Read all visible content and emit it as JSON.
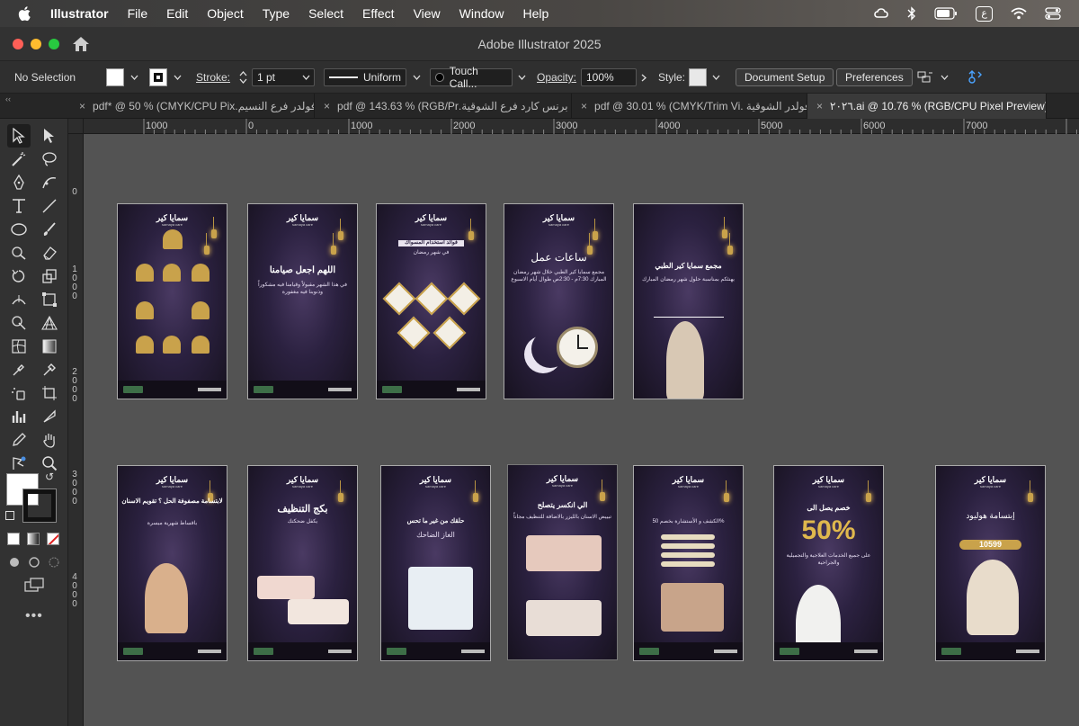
{
  "menubar": {
    "app": "Illustrator",
    "items": [
      "File",
      "Edit",
      "Object",
      "Type",
      "Select",
      "Effect",
      "View",
      "Window",
      "Help"
    ],
    "lang": "ع"
  },
  "window": {
    "title": "Adobe Illustrator 2025"
  },
  "control": {
    "selection": "No Selection",
    "stroke_label": "Stroke:",
    "stroke_value": "1 pt",
    "profile": "Uniform",
    "brush": "Touch Call...",
    "opacity_label": "Opacity:",
    "opacity_value": "100%",
    "style_label": "Style:",
    "document_setup": "Document Setup",
    "preferences": "Preferences"
  },
  "tabs": [
    {
      "label": "فولدر فرع النسيم.pdf* @ 50 % (CMYK/CPU Pix",
      "active": false
    },
    {
      "label": "برنس كارد فرع الشوقية.pdf @ 143.63 % (RGB/Pr",
      "active": false
    },
    {
      "label": "فولدر الشوقية .pdf @ 30.01 % (CMYK/Trim Vi",
      "active": false
    },
    {
      "label": "٢٠٢٦.ai @ 10.76 % (RGB/CPU Pixel Preview)",
      "active": true
    }
  ],
  "ruler_top": [
    "1000",
    "0",
    "1000",
    "2000",
    "3000",
    "4000",
    "5000",
    "6000",
    "7000"
  ],
  "ruler_left": [
    "0",
    "1000",
    "2000",
    "3000",
    "4000"
  ],
  "artboards": {
    "r1": [
      {
        "logo": "سمايا كير",
        "sub": "samaya care",
        "heading": "",
        "text": ""
      },
      {
        "logo": "سمايا كير",
        "sub": "samaya care",
        "heading": "اللهم اجعل صيامنا",
        "text": "في هذا الشهر مقبولاً وقيامنا فيه مشكوراً وذنوبنا فيه مغفورة"
      },
      {
        "logo": "سمايا كير",
        "sub": "samaya care",
        "heading": "فوائد استخدام المسواك",
        "text": "في شهر رمضان"
      },
      {
        "logo": "سمايا كير",
        "sub": "samaya care",
        "heading": "ساعات عمل",
        "text": "مجمع سمايا كير الطبي خلال شهر رمضان المبارك 7:30م - 2:30ص طوال أيام الاسبوع"
      },
      {
        "logo": "",
        "sub": "",
        "heading": "مجمع سمايا كير الطبي",
        "text": "يهنئكم بمناسبة حلول شهر رمضان المبارك"
      }
    ],
    "r2": [
      {
        "logo": "سمايا كير",
        "sub": "samaya care",
        "heading": "لابتسامة مصفوفة الحل ؟ تقويم الاسنان",
        "text": "باقساط شهرية ميسرة"
      },
      {
        "logo": "سمايا كير",
        "sub": "samaya care",
        "heading": "بكج التنظيف",
        "text": "يكفل ضحكتك"
      },
      {
        "logo": "سمايا كير",
        "sub": "samaya care",
        "heading": "حلقك من غير ما تحس",
        "text": "الغاز الضاحك"
      },
      {
        "logo": "سمايا كير",
        "sub": "samaya care",
        "heading": "الي انكسر يتصلح",
        "text": "تبييض الاسنان بالليزر بالاضافة للتنظيف مجاناً"
      },
      {
        "logo": "سمايا كير",
        "sub": "samaya care",
        "heading": "",
        "text": "الكشف و الأستشارة بخصم 50%"
      },
      {
        "logo": "سمايا كير",
        "sub": "samaya care",
        "heading": "خصم يصل الى",
        "text": "على جميع الخدمات العلاجية والتجميلية والجراحية"
      },
      {
        "logo": "سمايا كير",
        "sub": "samaya care",
        "heading": "إبتسامة هوليود",
        "text": "10599"
      }
    ],
    "big_number": "50%",
    "clock_time": "7:30"
  },
  "colors": {
    "accent": "#c9a24b",
    "panel": "#323232",
    "canvas": "#535353"
  }
}
